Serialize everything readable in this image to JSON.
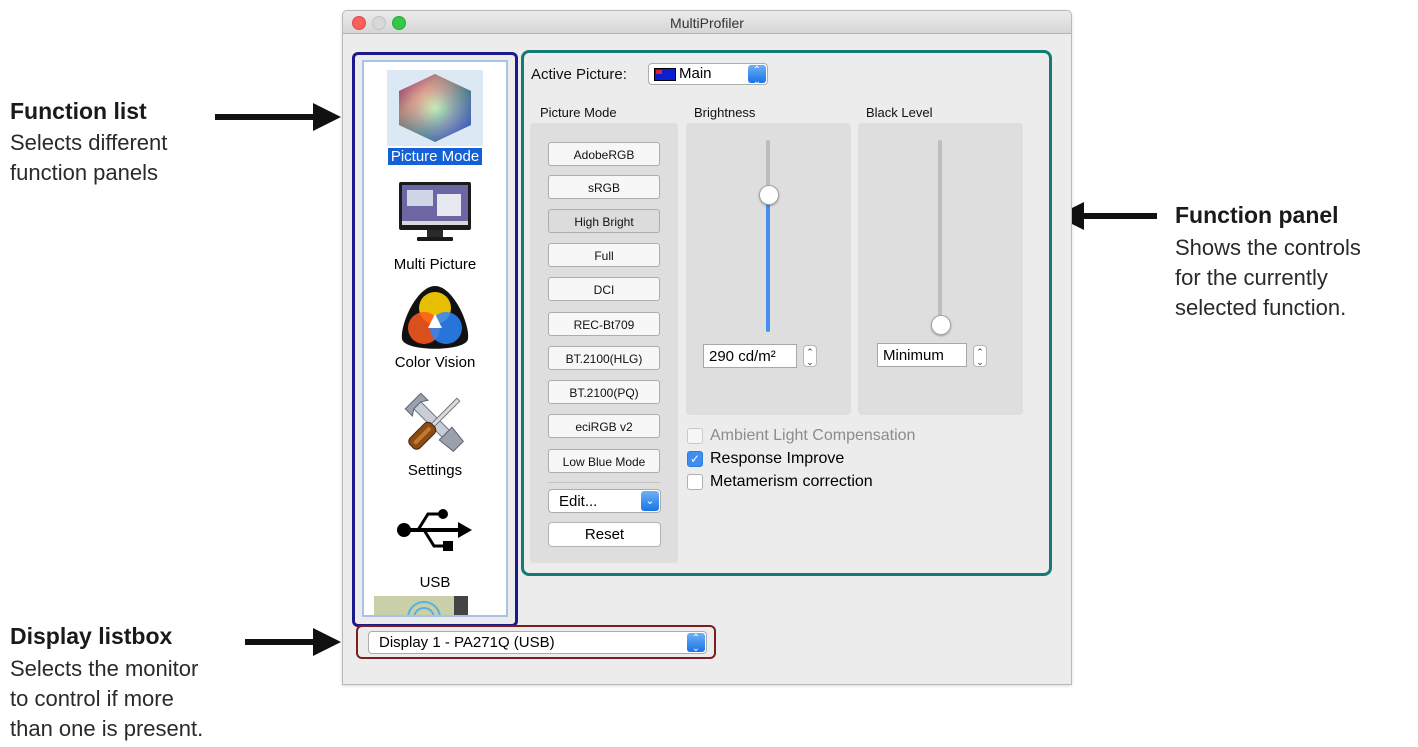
{
  "annotations": {
    "function_list": {
      "title": "Function list",
      "lines": [
        "Selects different",
        "function panels"
      ]
    },
    "function_panel": {
      "title": "Function panel",
      "lines": [
        "Shows the controls",
        "for the currently",
        "selected function."
      ]
    },
    "display_listbox": {
      "title": "Display listbox",
      "lines": [
        "Selects the monitor",
        "to control if more",
        "than one is present."
      ]
    }
  },
  "window": {
    "title": "MultiProfiler"
  },
  "sidebar": {
    "items": [
      {
        "label": "Picture Mode",
        "icon": "color-cube-icon",
        "selected": true
      },
      {
        "label": "Multi Picture",
        "icon": "monitor-icon",
        "selected": false
      },
      {
        "label": "Color Vision",
        "icon": "color-vision-icon",
        "selected": false
      },
      {
        "label": "Settings",
        "icon": "tools-icon",
        "selected": false
      },
      {
        "label": "USB",
        "icon": "usb-icon",
        "selected": false
      }
    ]
  },
  "panel": {
    "active_picture_label": "Active Picture:",
    "active_picture_value": "Main",
    "picture_mode": {
      "heading": "Picture Mode",
      "modes": [
        "AdobeRGB",
        "sRGB",
        "High Bright",
        "Full",
        "DCI",
        "REC-Bt709",
        "BT.2100(HLG)",
        "BT.2100(PQ)",
        "eciRGB v2",
        "Low Blue Mode"
      ],
      "active": "High Bright",
      "edit_label": "Edit...",
      "reset_label": "Reset"
    },
    "brightness": {
      "heading": "Brightness",
      "value": "290 cd/m²",
      "level_fraction": 0.72
    },
    "black_level": {
      "heading": "Black Level",
      "value": "Minimum",
      "level_fraction": 0.0
    },
    "checkboxes": [
      {
        "label": "Ambient Light Compensation",
        "checked": false,
        "enabled": false
      },
      {
        "label": "Response Improve",
        "checked": true,
        "enabled": true
      },
      {
        "label": "Metamerism correction",
        "checked": false,
        "enabled": true
      }
    ]
  },
  "display_select": {
    "value": "Display 1 - PA271Q (USB)"
  },
  "colors": {
    "accent": "#1460d6",
    "sidebar_frame": "#1c1a8a",
    "panel_frame": "#137a76",
    "display_frame": "#7a1f1f"
  }
}
